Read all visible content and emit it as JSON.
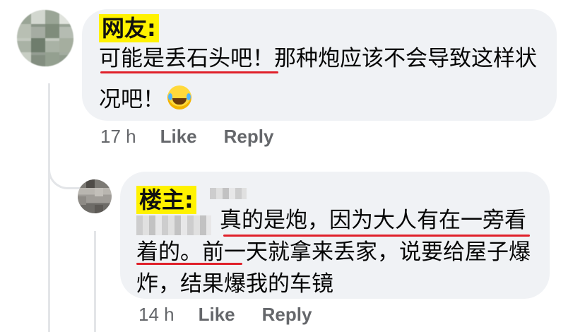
{
  "comments": [
    {
      "tag": "网友:",
      "text": "可能是丢石头吧！那种炮应该不会导致这样状况吧！",
      "emoji": "laughing-tears-emoji",
      "time": "17 h",
      "like_label": "Like",
      "reply_label": "Reply"
    },
    {
      "tag": "楼主:",
      "text": "真的是炮，因为大人有在一旁看着的。前一天就拿来丢家，说要给屋子爆炸，结果爆我的车镜",
      "time": "14 h",
      "like_label": "Like",
      "reply_label": "Reply"
    }
  ],
  "colors": {
    "bubble": "#f0f2f5",
    "tag_highlight": "#fff200",
    "underline": "#e0202a",
    "meta_text": "#65676b"
  }
}
